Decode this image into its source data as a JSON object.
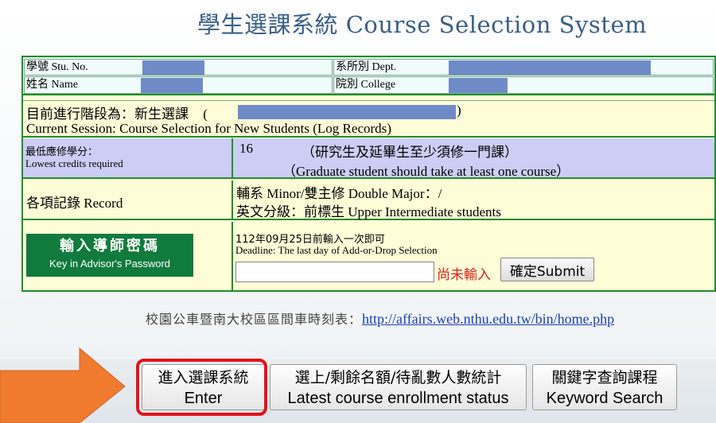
{
  "header": {
    "title": "學生選課系統 Course Selection System"
  },
  "student": {
    "stu_no_label": "學號 Stu. No.",
    "name_label": "姓名 Name",
    "dept_label": "系所別 Dept.",
    "college_label": "院別 College"
  },
  "session": {
    "zh": "目前進行階段為：新生選課",
    "paren_open": "(",
    "paren_close": ")",
    "en": "Current Session: Course Selection for New Students (Log Records)"
  },
  "credits": {
    "label_zh": "最低應修學分：",
    "label_en": "Lowest credits required",
    "value": "16",
    "note_zh": "（研究生及延畢生至少須修一門課）",
    "note_en": "（Graduate student should take at least one course）"
  },
  "record": {
    "label": "各項記錄 Record",
    "minor": "輔系 Minor/雙主修 Double Major：/",
    "english": "英文分級：前標生 Upper Intermediate students"
  },
  "advisor": {
    "button_zh": "輸入導師密碼",
    "button_en": "Key in Advisor's Password",
    "deadline_zh": "112年09月25日前輸入一次即可",
    "deadline_en": "Deadline: The last day of Add-or-Drop Selection",
    "password_value": "",
    "status": "尚未輸入",
    "submit": "確定Submit"
  },
  "bus": {
    "label": "校園公車暨南大校區區間車時刻表：",
    "link": "http://affairs.web.nthu.edu.tw/bin/home.php"
  },
  "nav": {
    "enter_zh": "進入選課系統",
    "enter_en": "Enter",
    "status_zh": "選上/剩餘名額/待亂數人數統計",
    "status_en": "Latest course enrollment status",
    "keyword_zh": "關鍵字查詢課程",
    "keyword_en": "Keyword Search"
  },
  "colors": {
    "border_green": "#1f8e2c",
    "cell_yellow": "#fefdd8",
    "cell_lavender": "#cdcdf5",
    "redacted_blue": "#6f8bc7",
    "highlight_red": "#e2141a",
    "arrow_orange": "#f07b2f"
  }
}
